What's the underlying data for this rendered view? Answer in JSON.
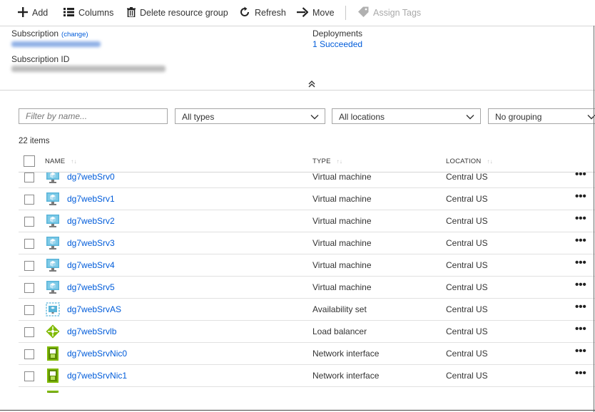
{
  "toolbar": {
    "add": "Add",
    "columns": "Columns",
    "delete": "Delete resource group",
    "refresh": "Refresh",
    "move": "Move",
    "assign_tags": "Assign Tags"
  },
  "essentials": {
    "subscription_label": "Subscription",
    "change_link": "(change)",
    "subscription_id_label": "Subscription ID",
    "deployments_label": "Deployments",
    "deployments_value": "1 Succeeded"
  },
  "filters": {
    "name_placeholder": "Filter by name...",
    "types": "All types",
    "locations": "All locations",
    "grouping": "No grouping"
  },
  "item_count": "22 items",
  "table": {
    "headers": {
      "name": "NAME",
      "type": "TYPE",
      "location": "LOCATION"
    },
    "rows": [
      {
        "name": "dg7webSrv0",
        "type": "Virtual machine",
        "location": "Central US",
        "icon": "vm-icon"
      },
      {
        "name": "dg7webSrv1",
        "type": "Virtual machine",
        "location": "Central US",
        "icon": "vm-icon"
      },
      {
        "name": "dg7webSrv2",
        "type": "Virtual machine",
        "location": "Central US",
        "icon": "vm-icon"
      },
      {
        "name": "dg7webSrv3",
        "type": "Virtual machine",
        "location": "Central US",
        "icon": "vm-icon"
      },
      {
        "name": "dg7webSrv4",
        "type": "Virtual machine",
        "location": "Central US",
        "icon": "vm-icon"
      },
      {
        "name": "dg7webSrv5",
        "type": "Virtual machine",
        "location": "Central US",
        "icon": "vm-icon"
      },
      {
        "name": "dg7webSrvAS",
        "type": "Availability set",
        "location": "Central US",
        "icon": "availability-set-icon"
      },
      {
        "name": "dg7webSrvlb",
        "type": "Load balancer",
        "location": "Central US",
        "icon": "load-balancer-icon"
      },
      {
        "name": "dg7webSrvNic0",
        "type": "Network interface",
        "location": "Central US",
        "icon": "network-interface-icon"
      },
      {
        "name": "dg7webSrvNic1",
        "type": "Network interface",
        "location": "Central US",
        "icon": "network-interface-icon"
      }
    ],
    "more_glyph": "•••"
  },
  "colors": {
    "link": "#015cda",
    "vm": "#59b4d9",
    "nic": "#7fba00"
  }
}
